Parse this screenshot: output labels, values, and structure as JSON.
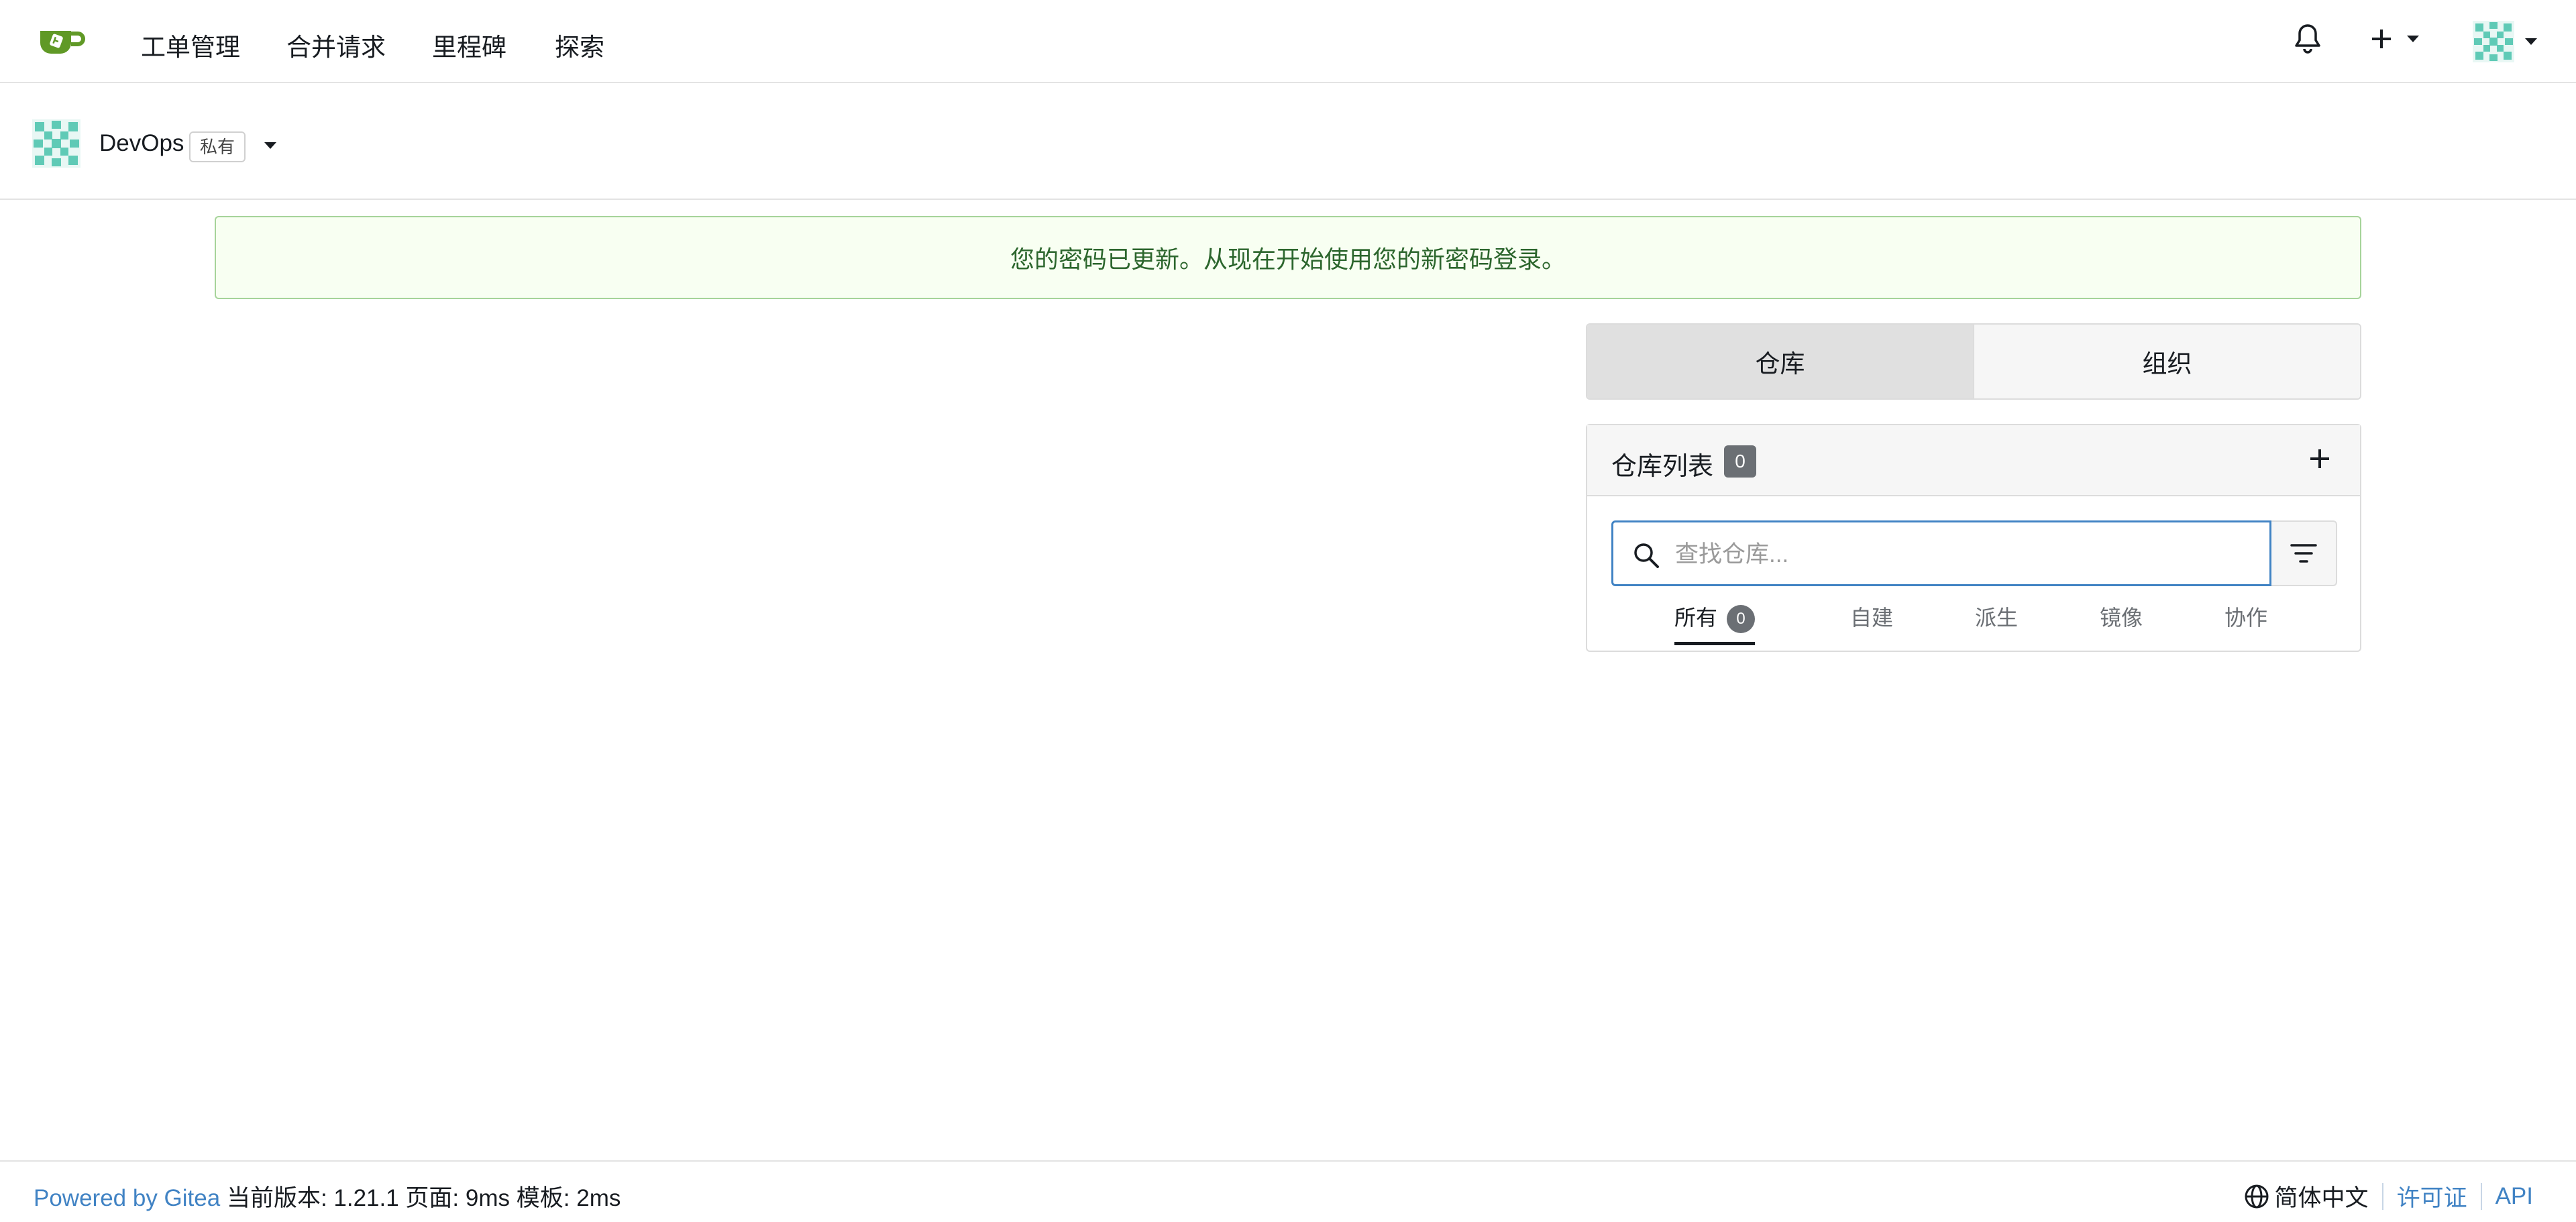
{
  "nav": {
    "items": [
      "工单管理",
      "合并请求",
      "里程碑",
      "探索"
    ]
  },
  "org": {
    "name": "DevOps",
    "badge": "私有"
  },
  "flash": {
    "message": "您的密码已更新。从现在开始使用您的新密码登录。"
  },
  "tabs": {
    "repos": "仓库",
    "orgs": "组织"
  },
  "repo_panel": {
    "title": "仓库列表",
    "count": "0",
    "search_placeholder": "查找仓库...",
    "sub_tabs": [
      {
        "label": "所有",
        "count": "0"
      },
      {
        "label": "自建"
      },
      {
        "label": "派生"
      },
      {
        "label": "镜像"
      },
      {
        "label": "协作"
      }
    ]
  },
  "footer": {
    "powered": "Powered by Gitea",
    "version_text": "当前版本: 1.21.1 页面:",
    "page_time": "9ms",
    "template_label": "模板:",
    "template_time": "2ms",
    "language": "简体中文",
    "license": "许可证",
    "api": "API"
  },
  "colors": {
    "accent": "#4183c4",
    "success_bg": "#f8fff2",
    "success_text": "#2c662d",
    "brand": "#609926"
  }
}
